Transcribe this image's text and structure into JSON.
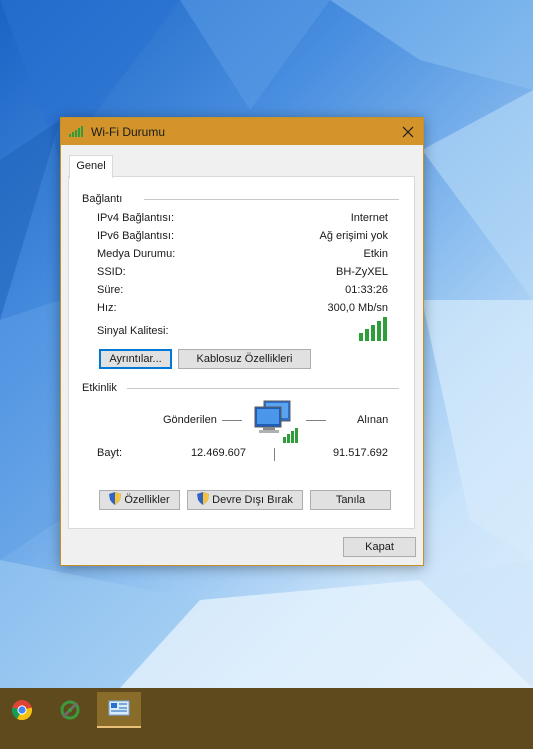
{
  "window": {
    "title": "Wi-Fi Durumu",
    "tab": "Genel"
  },
  "connection": {
    "heading": "Bağlantı",
    "rows": [
      {
        "label": "IPv4 Bağlantısı:",
        "value": "Internet"
      },
      {
        "label": "IPv6 Bağlantısı:",
        "value": "Ağ erişimi yok"
      },
      {
        "label": "Medya Durumu:",
        "value": "Etkin"
      },
      {
        "label": "SSID:",
        "value": "BH-ZyXEL"
      },
      {
        "label": "Süre:",
        "value": "01:33:26"
      },
      {
        "label": "Hız:",
        "value": "300,0 Mb/sn"
      }
    ],
    "signal_label": "Sinyal Kalitesi:",
    "signal_bars": 5,
    "details_button": "Ayrıntılar...",
    "wireless_props_button": "Kablosuz Özellikleri"
  },
  "activity": {
    "heading": "Etkinlik",
    "sent_label": "Gönderilen",
    "received_label": "Alınan",
    "bytes_label": "Bayt:",
    "bytes_sent": "12.469.607",
    "bytes_received": "91.517.692"
  },
  "buttons": {
    "properties": "Özellikler",
    "disable": "Devre Dışı Bırak",
    "diagnose": "Tanıla",
    "close": "Kapat"
  },
  "icons": {
    "title": "wifi-signal-icon",
    "close": "close-icon",
    "signal": "signal-strength-icon",
    "network": "network-computers-icon",
    "shield": "uac-shield-icon",
    "taskbar": [
      "chrome-icon",
      "tool-icon",
      "network-status-icon"
    ]
  },
  "colors": {
    "titlebar": "#d3952b",
    "taskbar": "#5e4a1c",
    "signal_green": "#2e9e3a",
    "accent_blue": "#0078d7"
  }
}
